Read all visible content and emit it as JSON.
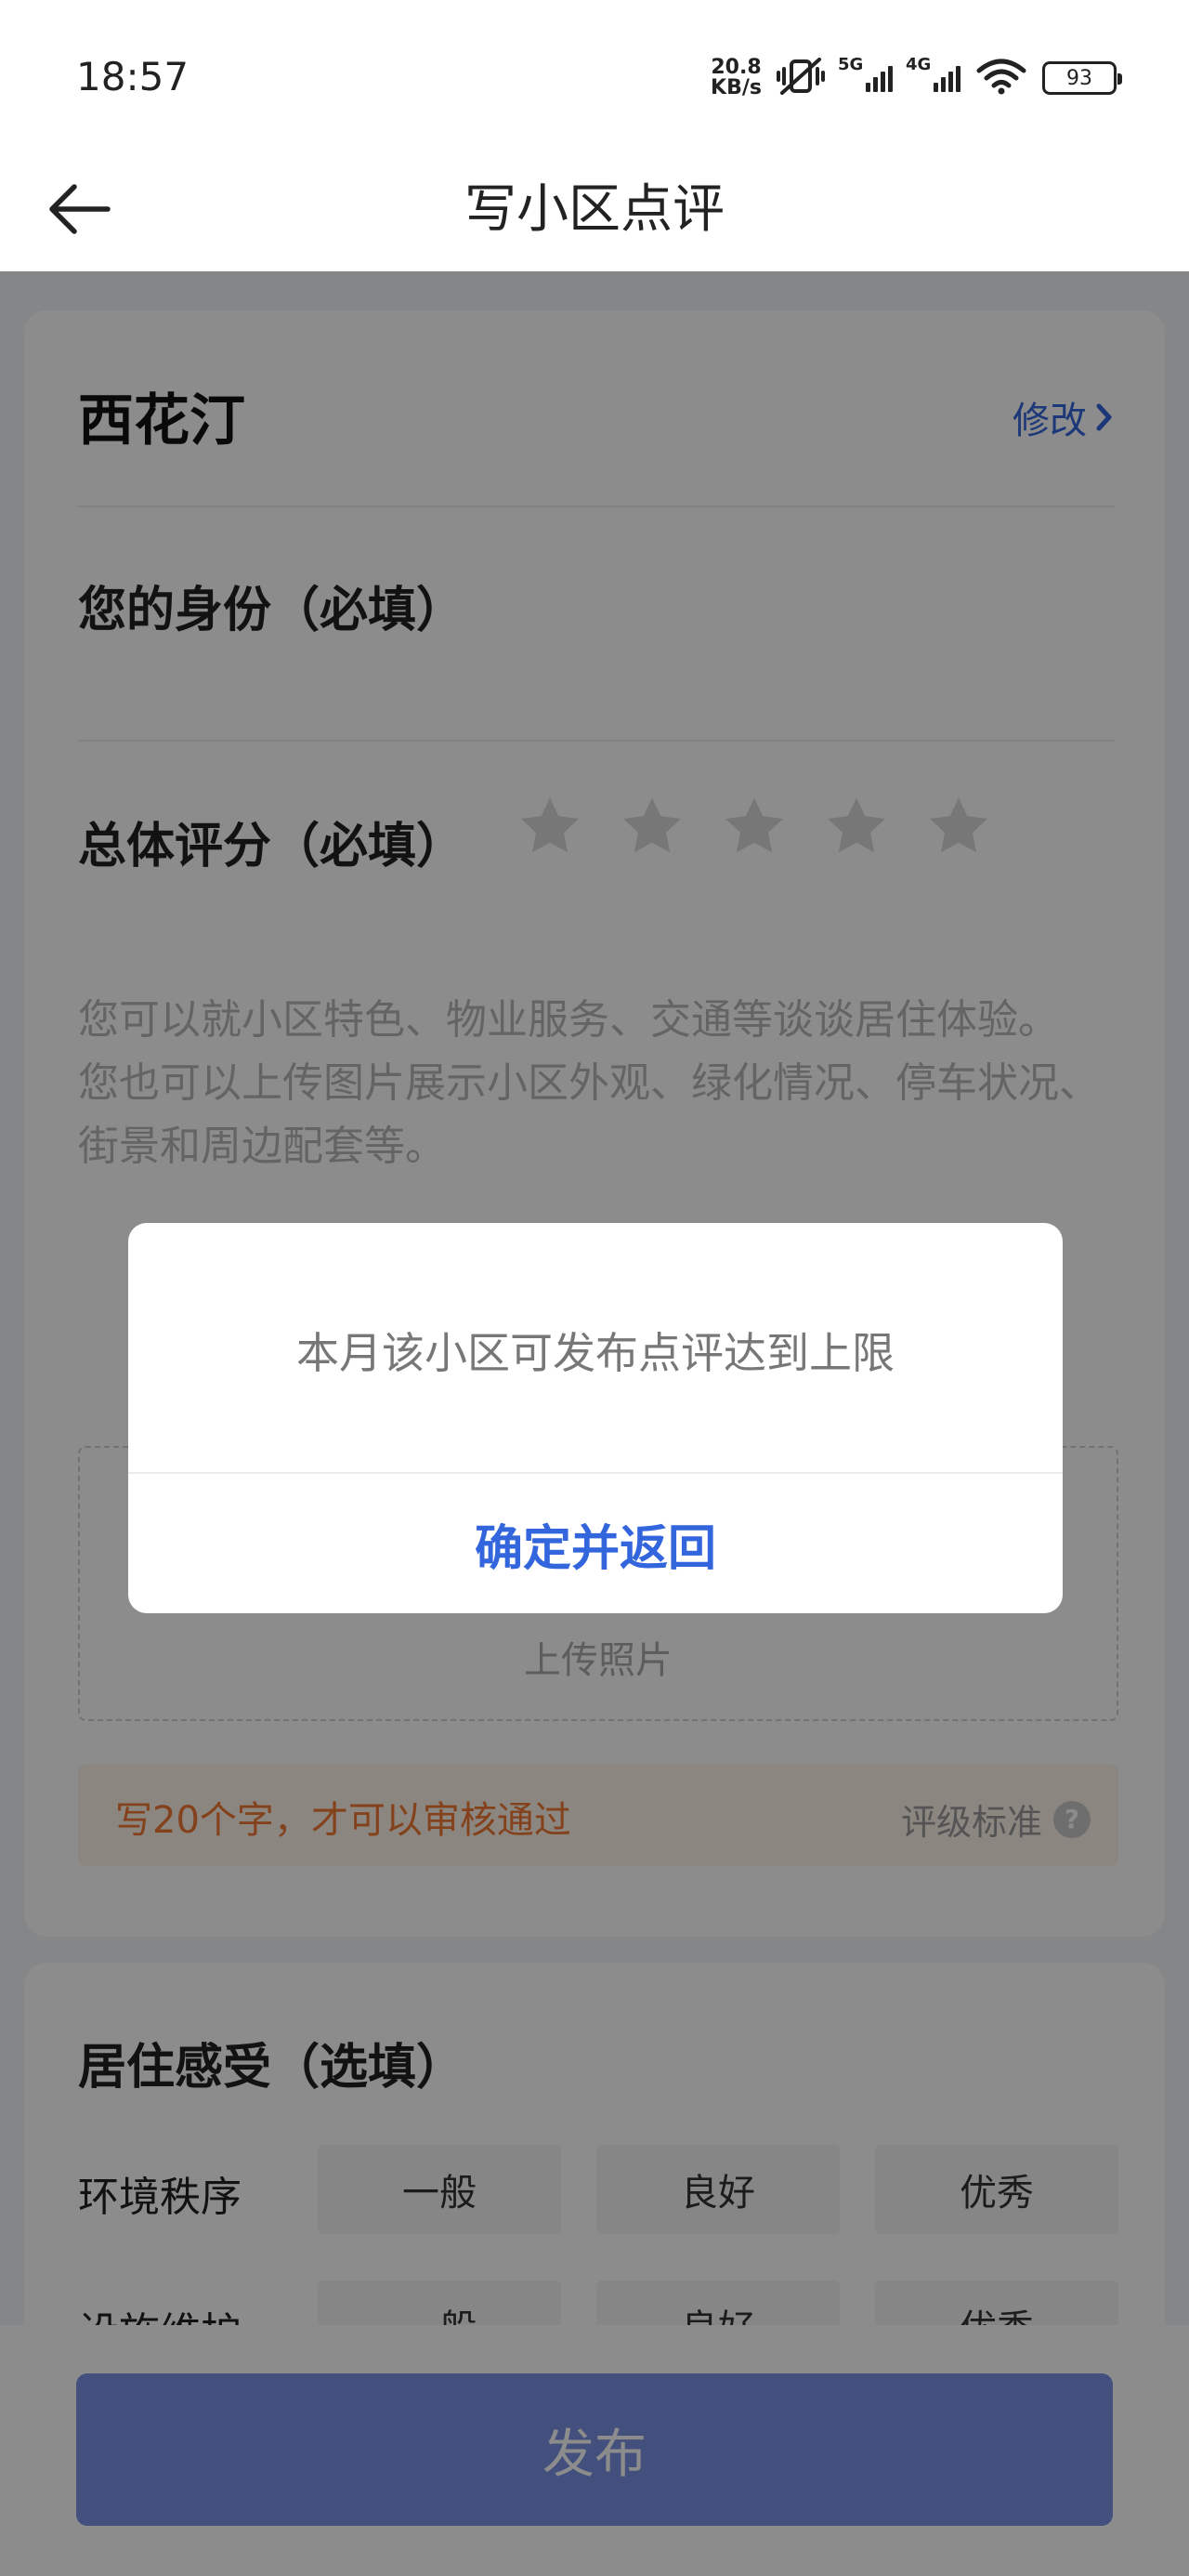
{
  "status_bar": {
    "time": "18:57",
    "speed_value": "20.8",
    "speed_unit": "KB/s",
    "sig1_label": "5G",
    "sig2_label": "4G",
    "battery": "93"
  },
  "header": {
    "title": "写小区点评"
  },
  "community": {
    "name": "西花汀",
    "modify_label": "修改"
  },
  "identity": {
    "label": "您的身份（必填）"
  },
  "rating": {
    "label": "总体评分（必填）",
    "stars_filled": 0,
    "stars_total": 5
  },
  "review": {
    "placeholder_line1": "您可以就小区特色、物业服务、交通等谈谈居住体验。",
    "placeholder_line2": "您也可以上传图片展示小区外观、绿化情况、停车状况、街景和周边配套等。"
  },
  "upload": {
    "label": "上传照片"
  },
  "hint": {
    "text": "写20个字，才可以审核通过",
    "standard_label": "评级标准",
    "help_icon_text": "?"
  },
  "living": {
    "title": "居住感受（选填）",
    "rows": [
      {
        "label": "环境秩序",
        "options": [
          "一般",
          "良好",
          "优秀"
        ]
      },
      {
        "label": "设施维护",
        "options": [
          "一般",
          "良好",
          "优秀"
        ]
      }
    ]
  },
  "footer": {
    "publish_label": "发布"
  },
  "dialog": {
    "message": "本月该小区可发布点评达到上限",
    "confirm_label": "确定并返回"
  },
  "colors": {
    "accent": "#3366dd",
    "publish_bg": "#7a92e6",
    "hint_text": "#ee7733",
    "hint_bg": "#fff4ec"
  }
}
